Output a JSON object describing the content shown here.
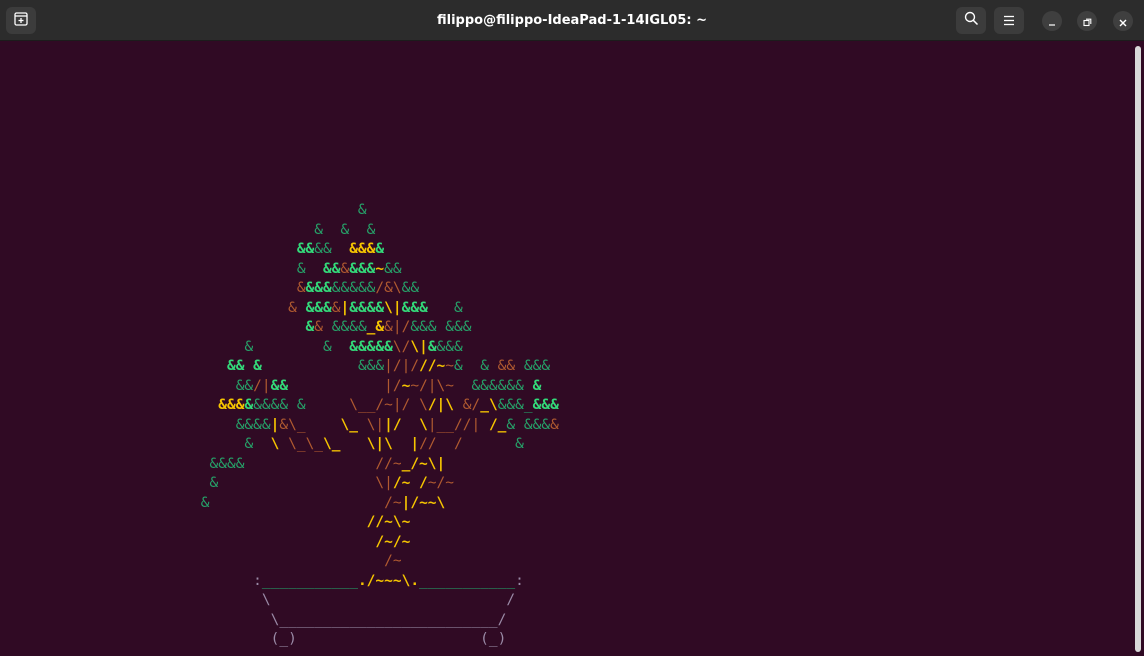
{
  "window": {
    "title": "filippo@filippo-IdeaPad-1-14IGL05: ~",
    "icons": {
      "new_tab": "new-tab-icon",
      "search": "search-icon",
      "menu": "hamburger-menu-icon",
      "minimize": "minimize-icon",
      "maximize": "maximize-icon",
      "close": "close-icon"
    }
  },
  "colors": {
    "terminal_bg": "#300a24",
    "titlebar_bg": "#2c2c2c",
    "leaf_green": "#26a269",
    "leaf_green_bright": "#33da7a",
    "trunk_yellow": "#d4a10a",
    "trunk_yellow_bright": "#f6c500",
    "branch_brown": "#b05a30",
    "pot_gray": "#9a8aa6"
  },
  "bonsai": [
    [
      {
        "t": "                                         "
      },
      {
        "c": "g",
        "t": "&"
      }
    ],
    [
      {
        "t": "                                    "
      },
      {
        "c": "g",
        "t": "&  &  &"
      }
    ],
    [
      {
        "t": "                                  "
      },
      {
        "c": "gb",
        "t": "&&"
      },
      {
        "c": "g",
        "t": "&&  "
      },
      {
        "c": "yb",
        "t": "&&&"
      },
      {
        "c": "gb",
        "t": "&"
      }
    ],
    [
      {
        "t": "                                  "
      },
      {
        "c": "g",
        "t": "&  "
      },
      {
        "c": "gb",
        "t": "&&"
      },
      {
        "c": "r",
        "t": "&"
      },
      {
        "c": "gb",
        "t": "&&&"
      },
      {
        "c": "yb",
        "t": "~"
      },
      {
        "c": "g",
        "t": "&&"
      }
    ],
    [
      {
        "t": "                                  "
      },
      {
        "c": "r",
        "t": "&"
      },
      {
        "c": "gb",
        "t": "&&&"
      },
      {
        "c": "g",
        "t": "&&&&&"
      },
      {
        "c": "r",
        "t": "/&\\"
      },
      {
        "c": "g",
        "t": "&&"
      }
    ],
    [
      {
        "t": "                                 "
      },
      {
        "c": "r",
        "t": "& "
      },
      {
        "c": "gb",
        "t": "&&&"
      },
      {
        "c": "r",
        "t": "&"
      },
      {
        "c": "yb",
        "t": "|"
      },
      {
        "c": "gb",
        "t": "&&&&"
      },
      {
        "c": "yb",
        "t": "\\|"
      },
      {
        "c": "gb",
        "t": "&&&"
      },
      {
        "t": "   "
      },
      {
        "c": "g",
        "t": "&"
      }
    ],
    [
      {
        "t": "                                   "
      },
      {
        "c": "gb",
        "t": "&"
      },
      {
        "c": "r",
        "t": "& "
      },
      {
        "c": "g",
        "t": "&&&&"
      },
      {
        "c": "yb",
        "t": "_&"
      },
      {
        "c": "r",
        "t": "&|/"
      },
      {
        "c": "g",
        "t": "&&& &&&"
      }
    ],
    [
      {
        "t": "                            "
      },
      {
        "c": "g",
        "t": "&"
      },
      {
        "t": "        "
      },
      {
        "c": "g",
        "t": "&  "
      },
      {
        "c": "gb",
        "t": "&&&&&"
      },
      {
        "c": "r",
        "t": "\\/"
      },
      {
        "c": "yb",
        "t": "\\|"
      },
      {
        "c": "gb",
        "t": "&"
      },
      {
        "c": "g",
        "t": "&&&"
      }
    ],
    [
      {
        "t": "                          "
      },
      {
        "c": "gb",
        "t": "&& &"
      },
      {
        "t": "           "
      },
      {
        "c": "g",
        "t": "&&&"
      },
      {
        "c": "r",
        "t": "|/|/"
      },
      {
        "c": "yb",
        "t": "//~"
      },
      {
        "c": "r",
        "t": "~"
      },
      {
        "c": "g",
        "t": "&  & "
      },
      {
        "c": "r",
        "t": "&&"
      },
      {
        "c": "g",
        "t": " &&&"
      }
    ],
    [
      {
        "t": "                           "
      },
      {
        "c": "g",
        "t": "&&"
      },
      {
        "c": "r",
        "t": "/|"
      },
      {
        "c": "gb",
        "t": "&&"
      },
      {
        "t": "           "
      },
      {
        "c": "r",
        "t": "|/"
      },
      {
        "c": "yb",
        "t": "~"
      },
      {
        "c": "r",
        "t": "~/|\\~  "
      },
      {
        "c": "g",
        "t": "&&&&&& "
      },
      {
        "c": "gb",
        "t": "&"
      }
    ],
    [
      {
        "t": "                         "
      },
      {
        "c": "yb",
        "t": "&&&"
      },
      {
        "c": "gb",
        "t": "&"
      },
      {
        "c": "g",
        "t": "&&&& &"
      },
      {
        "t": "     "
      },
      {
        "c": "r",
        "t": "\\__/~|/ \\"
      },
      {
        "c": "yb",
        "t": "/|\\"
      },
      {
        "c": "r",
        "t": " &/"
      },
      {
        "c": "yb",
        "t": "_\\"
      },
      {
        "c": "g",
        "t": "&&&_"
      },
      {
        "c": "gb",
        "t": "&&&"
      }
    ],
    [
      {
        "t": "                           "
      },
      {
        "c": "g",
        "t": "&&&&"
      },
      {
        "c": "yb",
        "t": "|"
      },
      {
        "c": "r",
        "t": "&\\_"
      },
      {
        "t": "    "
      },
      {
        "c": "yb",
        "t": "\\_ "
      },
      {
        "c": "r",
        "t": "\\|"
      },
      {
        "c": "yb",
        "t": "|/"
      },
      {
        "c": "r",
        "t": "  "
      },
      {
        "c": "yb",
        "t": "\\"
      },
      {
        "c": "r",
        "t": "|__//| "
      },
      {
        "c": "yb",
        "t": "/_"
      },
      {
        "c": "g",
        "t": "& &&&"
      },
      {
        "c": "r",
        "t": "&"
      }
    ],
    [
      {
        "t": "                            "
      },
      {
        "c": "g",
        "t": "&  "
      },
      {
        "c": "yb",
        "t": "\\ "
      },
      {
        "c": "r",
        "t": "\\_\\_"
      },
      {
        "c": "yb",
        "t": "\\_"
      },
      {
        "t": "   "
      },
      {
        "c": "yb",
        "t": "\\|\\"
      },
      {
        "t": "  "
      },
      {
        "c": "yb",
        "t": "|"
      },
      {
        "c": "r",
        "t": "//  /"
      },
      {
        "t": "      "
      },
      {
        "c": "g",
        "t": "&"
      }
    ],
    [
      {
        "t": "                        "
      },
      {
        "c": "g",
        "t": "&&&&"
      },
      {
        "t": "               "
      },
      {
        "c": "r",
        "t": "//~"
      },
      {
        "c": "yb",
        "t": "_/~\\|"
      }
    ],
    [
      {
        "t": "                        "
      },
      {
        "c": "g",
        "t": "&"
      },
      {
        "t": "                  "
      },
      {
        "c": "r",
        "t": "\\|"
      },
      {
        "c": "yb",
        "t": "/~ /"
      },
      {
        "c": "r",
        "t": "~/~"
      }
    ],
    [
      {
        "t": "                       "
      },
      {
        "c": "g",
        "t": "&"
      },
      {
        "t": "                    "
      },
      {
        "c": "r",
        "t": "/~"
      },
      {
        "c": "yb",
        "t": "|/~~\\"
      }
    ],
    [
      {
        "t": "                                          "
      },
      {
        "c": "yb",
        "t": "//~\\~"
      }
    ],
    [
      {
        "t": "                                           "
      },
      {
        "c": "yb",
        "t": "/~/~"
      }
    ],
    [
      {
        "t": "                                            "
      },
      {
        "c": "r",
        "t": "/~"
      }
    ],
    [
      {
        "t": "                             "
      },
      {
        "c": "p",
        "t": ":"
      },
      {
        "c": "g",
        "t": "___________"
      },
      {
        "c": "yb",
        "t": "./~~~\\."
      },
      {
        "c": "g",
        "t": "___________"
      },
      {
        "c": "p",
        "t": ":"
      }
    ],
    [
      {
        "t": "                              "
      },
      {
        "c": "p",
        "t": "\\                           /"
      }
    ],
    [
      {
        "t": "                               "
      },
      {
        "c": "p",
        "t": "\\_________________________/"
      }
    ],
    [
      {
        "t": "                               "
      },
      {
        "c": "p",
        "t": "(_)                     (_)"
      }
    ]
  ]
}
